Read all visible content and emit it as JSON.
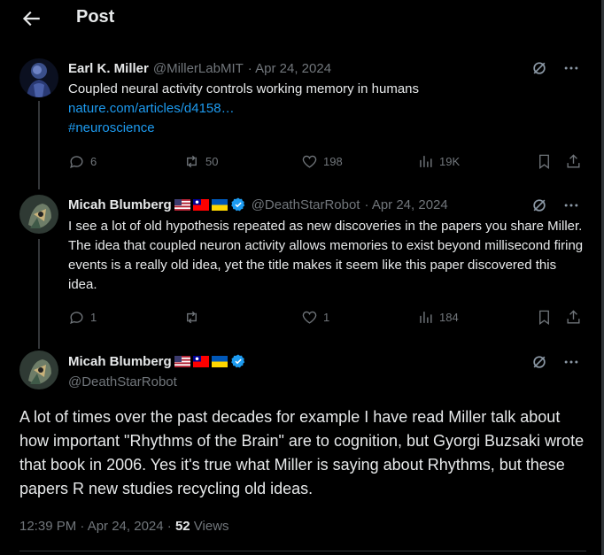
{
  "header": {
    "title": "Post"
  },
  "tweets": [
    {
      "name": "Earl K. Miller",
      "handle": "@MillerLabMIT",
      "date": "· Apr 24, 2024",
      "text": "Coupled neural activity controls working memory in humans",
      "link": "nature.com/articles/d4158…",
      "hashtag": "#neuroscience",
      "replies": "6",
      "reposts": "50",
      "likes": "198",
      "views": "19K"
    },
    {
      "name": "Micah Blumberg",
      "handle": "@DeathStarRobot",
      "date": "· Apr 24, 2024",
      "text": "I see a lot of old hypothesis repeated as new discoveries in the papers you share Miller. The idea that coupled neuron activity allows memories to exist beyond millisecond firing events is a really old idea, yet the title makes it seem like this paper discovered this idea.",
      "replies": "1",
      "reposts": "",
      "likes": "1",
      "views": "184"
    }
  ],
  "main_post": {
    "name": "Micah Blumberg",
    "handle": "@DeathStarRobot",
    "text": "A lot of times over the past decades for example I have read Miller talk about how important \"Rhythms of the Brain\" are to cognition, but Gyorgi Buzsaki wrote that book in 2006. Yes it's true what Miller is saying about Rhythms, but these papers R new studies recycling old ideas.",
    "time": "12:39 PM · Apr 24, 2024 · ",
    "views_count": "52",
    "views_label": " Views"
  },
  "icons": {
    "back": "arrow-left-icon",
    "grok": "grok-icon",
    "more": "more-icon",
    "reply": "reply-icon",
    "repost": "repost-icon",
    "like": "heart-icon",
    "views": "views-icon",
    "bookmark": "bookmark-icon",
    "share": "share-icon"
  },
  "colors": {
    "background": "#000000",
    "text": "#e7e9ea",
    "muted": "#71767b",
    "link": "#1d9bf0",
    "verified": "#1d9bf0"
  }
}
